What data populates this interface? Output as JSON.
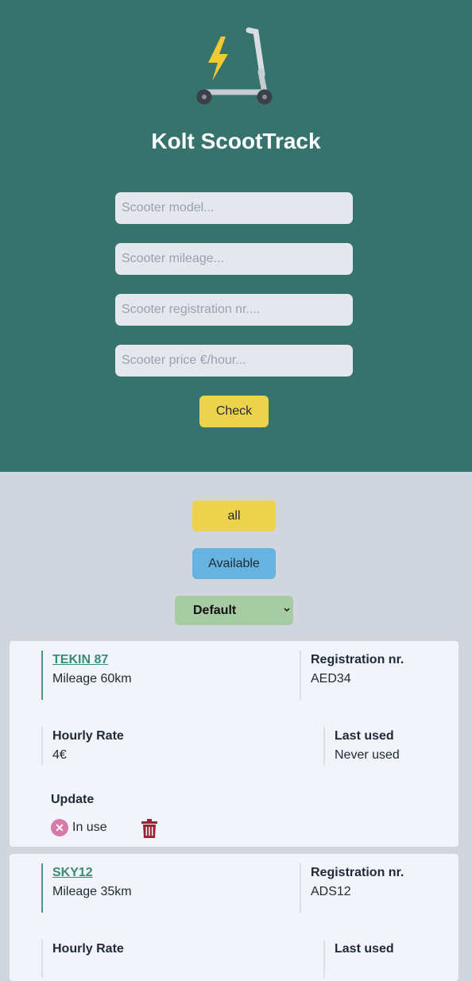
{
  "app": {
    "title": "Kolt ScootTrack"
  },
  "form": {
    "model_placeholder": "Scooter model...",
    "mileage_placeholder": "Scooter mileage...",
    "registration_placeholder": "Scooter registration nr....",
    "price_placeholder": "Scooter price €/hour...",
    "check_label": "Check"
  },
  "filters": {
    "all_label": "all",
    "available_label": "Available",
    "sort_selected": "Default"
  },
  "scooters": [
    {
      "name": "TEKIN 87",
      "mileage": "Mileage 60km",
      "registration_label": "Registration nr.",
      "registration": "AED34",
      "rate_label": "Hourly Rate",
      "rate": "4€",
      "last_used_label": "Last used",
      "last_used": "Never used",
      "update_label": "Update",
      "status": "In use"
    },
    {
      "name": "SKY12",
      "mileage": "Mileage 35km",
      "registration_label": "Registration nr.",
      "registration": "ADS12",
      "rate_label": "Hourly Rate",
      "last_used_label": "Last used"
    }
  ],
  "colors": {
    "header_bg": "#36736c",
    "page_bg": "#d1d5de",
    "accent_yellow": "#ecd24d",
    "accent_blue": "#66b3e0",
    "accent_green": "#a7cba3",
    "link_green": "#3c8a7a",
    "delete_red": "#9b2335"
  },
  "icons": [
    "scooter-logo-icon",
    "lightning-icon",
    "close-circle-icon",
    "trash-icon",
    "chevron-down-icon"
  ]
}
